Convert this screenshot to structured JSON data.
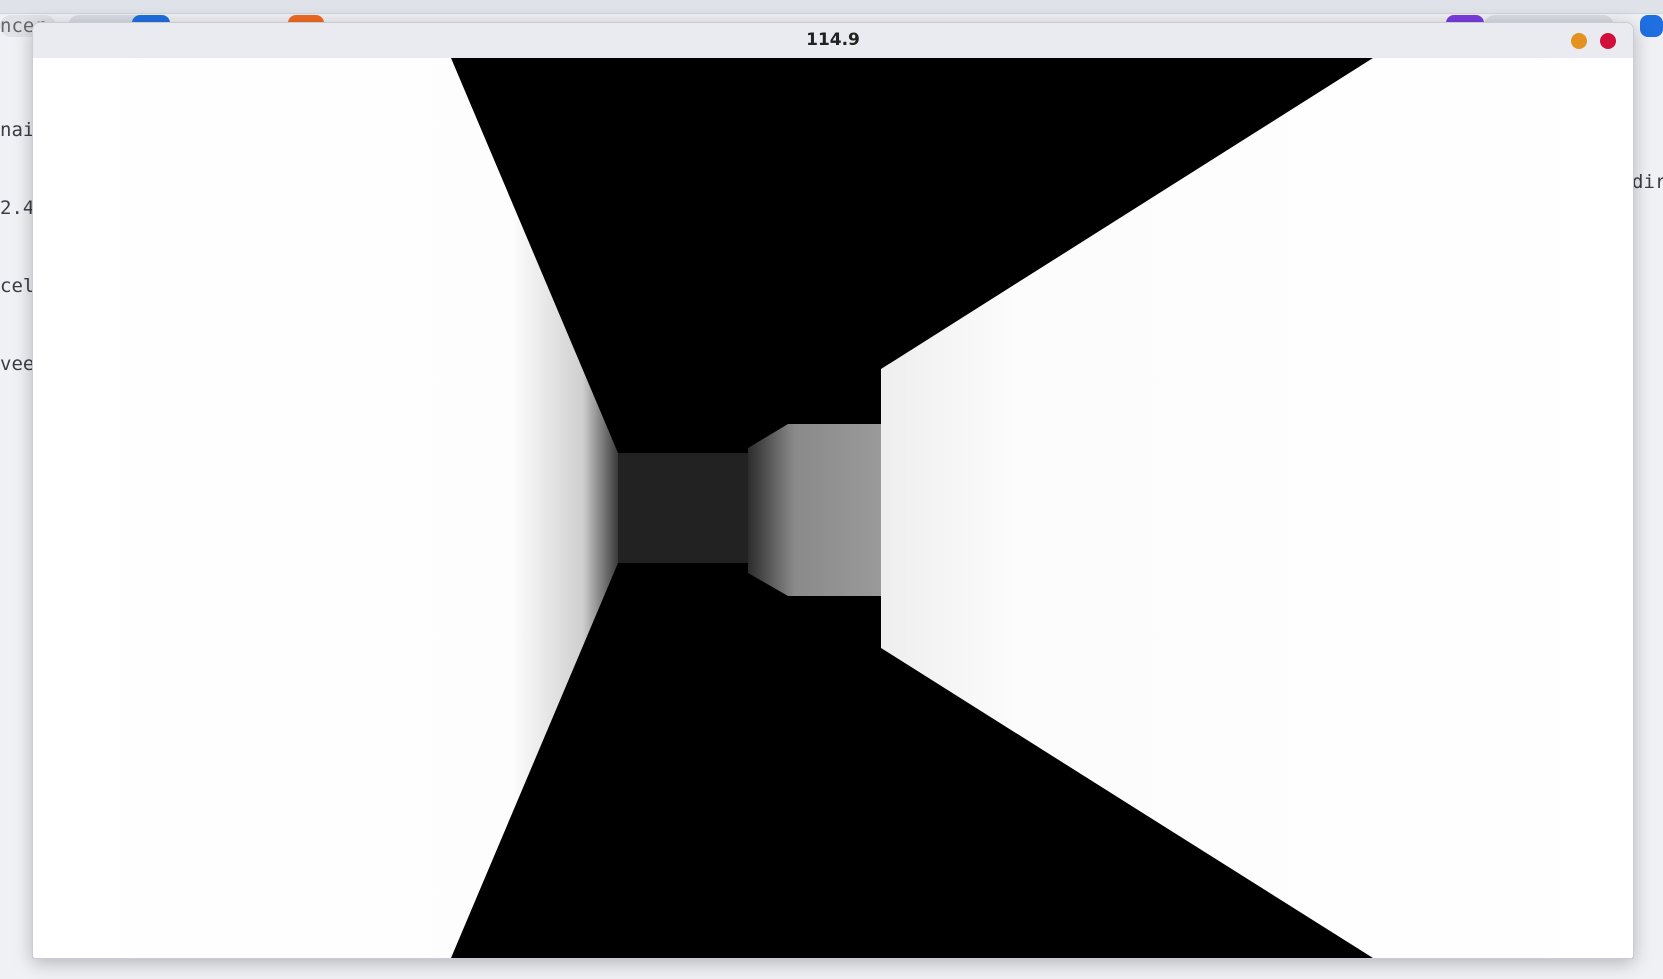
{
  "window": {
    "title": "114.9"
  },
  "controls": {
    "minimize_color": "#e3921f",
    "close_color": "#d0103a"
  },
  "background": {
    "left_code_lines": [
      "nain",
      "2.4",
      "cel,",
      "veen"
    ],
    "right_code_lines": [
      "dir"
    ],
    "tab_fragment": "ncer"
  },
  "scene": {
    "sky_color": "#000000",
    "floor_color": "#000000",
    "near_wall_color": "#ffffff",
    "far_wall_color": "#222222",
    "mid_wall_color": "#999999",
    "right_wall_color": "#f6f6f6"
  }
}
